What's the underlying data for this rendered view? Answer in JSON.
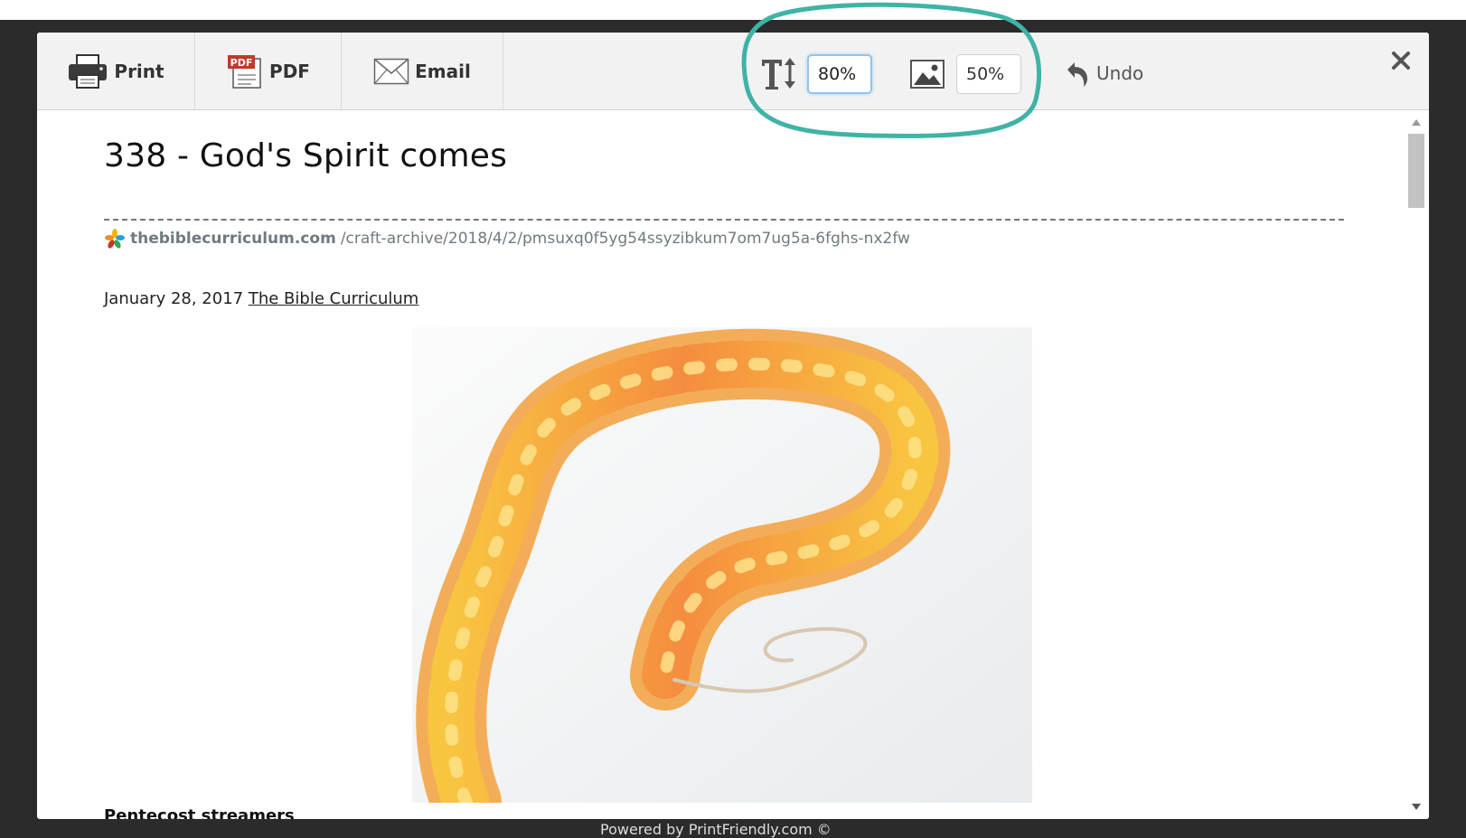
{
  "toolbar": {
    "print_label": "Print",
    "pdf_label": "PDF",
    "pdf_icon_text": "PDF",
    "email_label": "Email",
    "text_size_value": "80%",
    "image_size_value": "50%",
    "undo_label": "Undo",
    "icons": {
      "print": "printer-icon",
      "pdf": "pdf-file-icon",
      "email": "envelope-icon",
      "text_size": "text-size-icon",
      "image_size": "image-icon",
      "undo": "undo-arrow-icon",
      "close": "close-icon"
    }
  },
  "article": {
    "title": "338 - God's Spirit comes",
    "source_domain": "thebiblecurriculum.com",
    "source_path": "/craft-archive/2018/4/2/pmsuxq0f5yg54ssyzibkum7om7ug5a-6fghs-nx2fw",
    "date": "January 28, 2017",
    "author": "The Bible Curriculum",
    "next_heading_partial": "Pentecost streamers"
  },
  "footer": {
    "text_partial": "Powered by PrintFriendly.com ©"
  },
  "colors": {
    "annotation": "#3fb3a6",
    "toolbar_bg": "#f2f2f2",
    "backdrop": "#2b2b2b",
    "input_focus": "#8ec3f0",
    "pdf_badge": "#c0392b",
    "streamer_orange": "#f5893c",
    "streamer_yellow": "#f9c83e"
  }
}
